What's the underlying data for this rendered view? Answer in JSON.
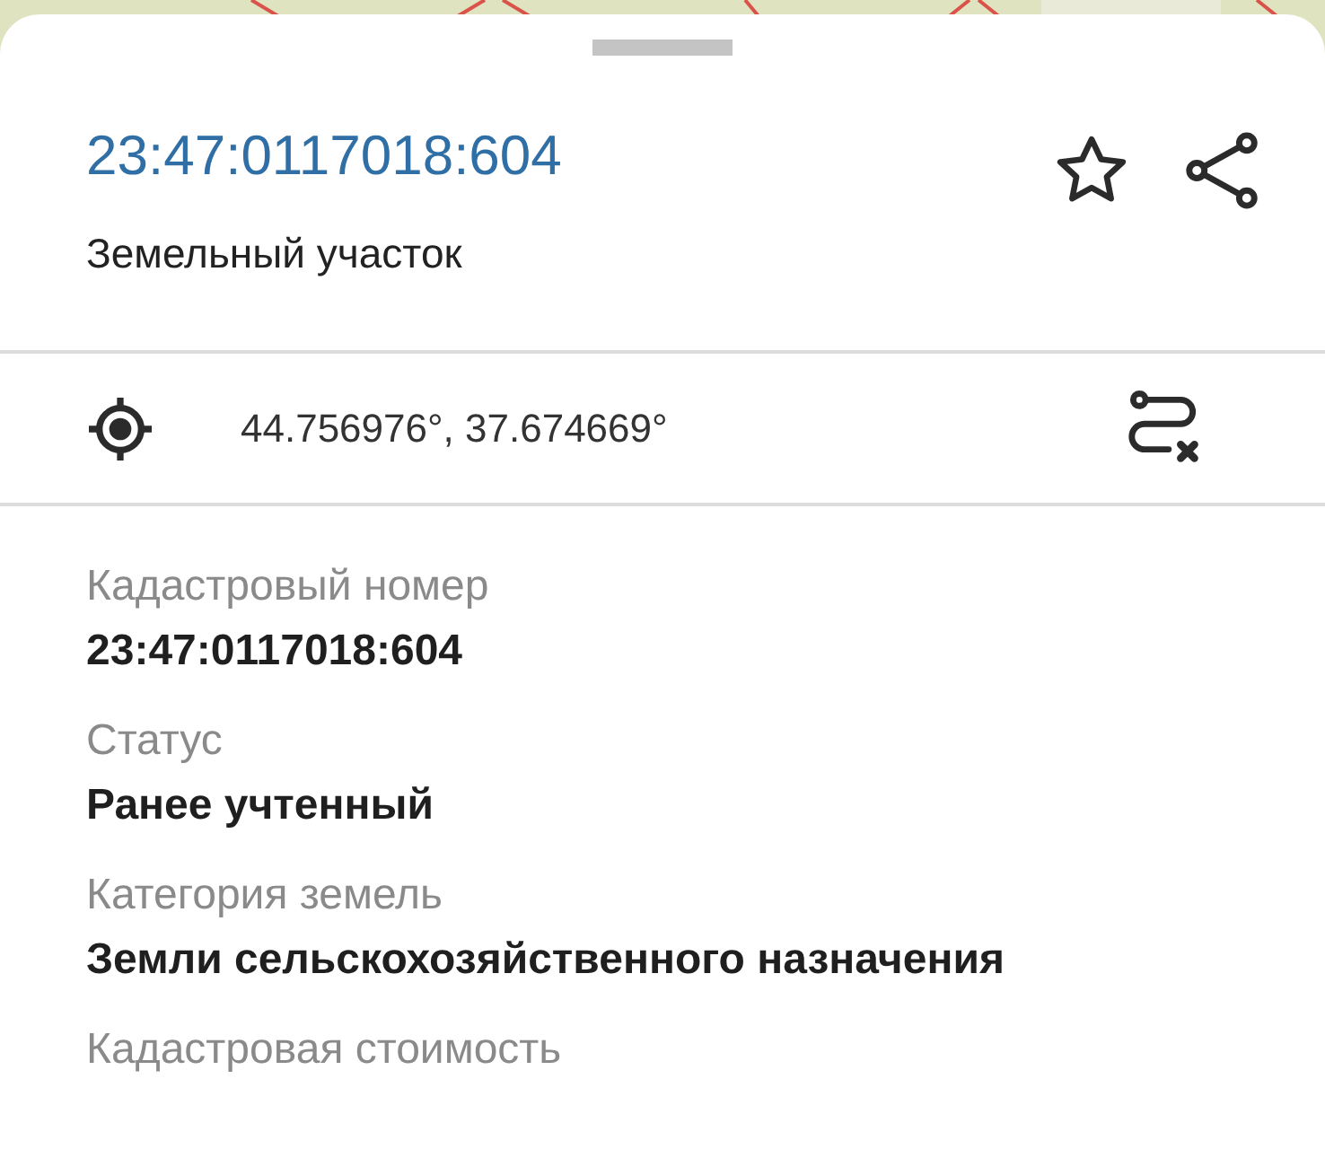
{
  "header": {
    "title": "23:47:0117018:604",
    "subtitle": "Земельный участок",
    "favorite": {
      "selected": false
    }
  },
  "location": {
    "coordinates": "44.756976°, 37.674669°"
  },
  "fields": [
    {
      "label": "Кадастровый номер",
      "value": "23:47:0117018:604"
    },
    {
      "label": "Статус",
      "value": "Ранее учтенный"
    },
    {
      "label": "Категория земель",
      "value": "Земли сельскохозяйственного назначения"
    },
    {
      "label": "Кадастровая стоимость"
    }
  ]
}
